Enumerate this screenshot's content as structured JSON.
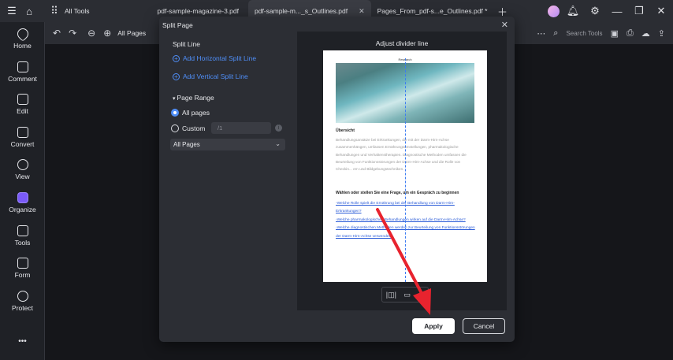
{
  "titlebar": {
    "all_tools": "All Tools",
    "tabs": [
      {
        "label": "pdf-sample-magazine-3.pdf"
      },
      {
        "label": "pdf-sample-m..._s_Outlines.pdf"
      },
      {
        "label": "Pages_From_pdf-s...e_Outlines.pdf *"
      }
    ]
  },
  "sidebar": {
    "items": [
      {
        "label": "Home"
      },
      {
        "label": "Comment"
      },
      {
        "label": "Edit"
      },
      {
        "label": "Convert"
      },
      {
        "label": "View"
      },
      {
        "label": "Organize"
      },
      {
        "label": "Tools"
      },
      {
        "label": "Form"
      },
      {
        "label": "Protect"
      }
    ],
    "more": "•••"
  },
  "toolbar": {
    "zoom_label": "All Pages",
    "search_placeholder": "Search Tools"
  },
  "dialog": {
    "title": "Split Page",
    "split_line_heading": "Split Line",
    "add_horizontal": "Add Horizontal Split Line",
    "add_vertical": "Add Vertical Split Line",
    "page_range_heading": "Page Range",
    "all_pages_option": "All pages",
    "custom_option": "Custom",
    "custom_placeholder": "/1",
    "page_select_value": "All Pages",
    "preview_title": "Adjust divider line",
    "apply_label": "Apply",
    "cancel_label": "Cancel"
  },
  "preview_page": {
    "header": "Research",
    "heading": "Übersicht",
    "paragraph": "Behandlungsansätze bei Erkrankungen, die mit der Darm-Hirn-Achse zusammenhängen, umfassen Ernährungsumstellungen, pharmakologische Behandlungen und Verhaltenstherapien. Diagnostische Methoden umfassen die Beurteilung von Funktionsstörungen der Darm-Hirn-Achse und die Rolle von Checkin... ern und Bildgebungstechniken.",
    "question": "Wählen oder stellen Sie eine Frage, um ein Gespräch zu beginnen",
    "links": [
      "-Welche Rolle spielt die Ernährung bei der Behandlung von Darm-Hirn-Erkrankungen?",
      "-Welche pharmakologischen Behandlungen wirken auf die Darm-Hirn-Achse?",
      "-Welche diagnostischen Methoden werden zur Beurteilung von Funktionsstörungen der Darm-Hirn-Achse verwendet?"
    ]
  },
  "colors": {
    "accent": "#4f8ef7",
    "arrow": "#e8232e"
  }
}
